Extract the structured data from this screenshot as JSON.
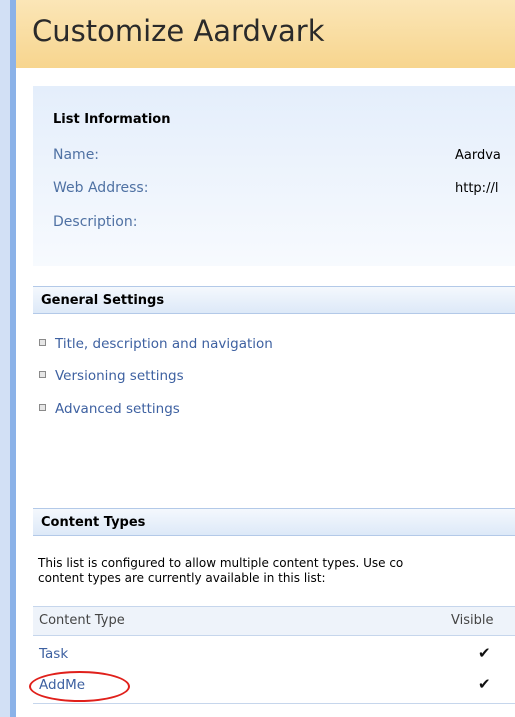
{
  "page": {
    "title": "Customize Aardvark"
  },
  "list_information": {
    "heading": "List Information",
    "name_label": "Name:",
    "name_value": "Aardva",
    "web_address_label": "Web Address:",
    "web_address_value": "http://l",
    "description_label": "Description:"
  },
  "general_settings": {
    "heading": "General Settings",
    "links": [
      "Title, description and navigation",
      "Versioning settings",
      "Advanced settings"
    ]
  },
  "content_types": {
    "heading": "Content Types",
    "description_line1": "This list is configured to allow multiple content types. Use co",
    "description_line2": "content types are currently available in this list:",
    "columns": [
      "Content Type",
      "Visible"
    ],
    "rows": [
      {
        "name": "Task",
        "visible": "✔"
      },
      {
        "name": "AddMe",
        "visible": "✔"
      }
    ]
  },
  "colors": {
    "highlight": "#e0201b",
    "link": "#3e61a1",
    "title_bar": "#f7d58e"
  }
}
